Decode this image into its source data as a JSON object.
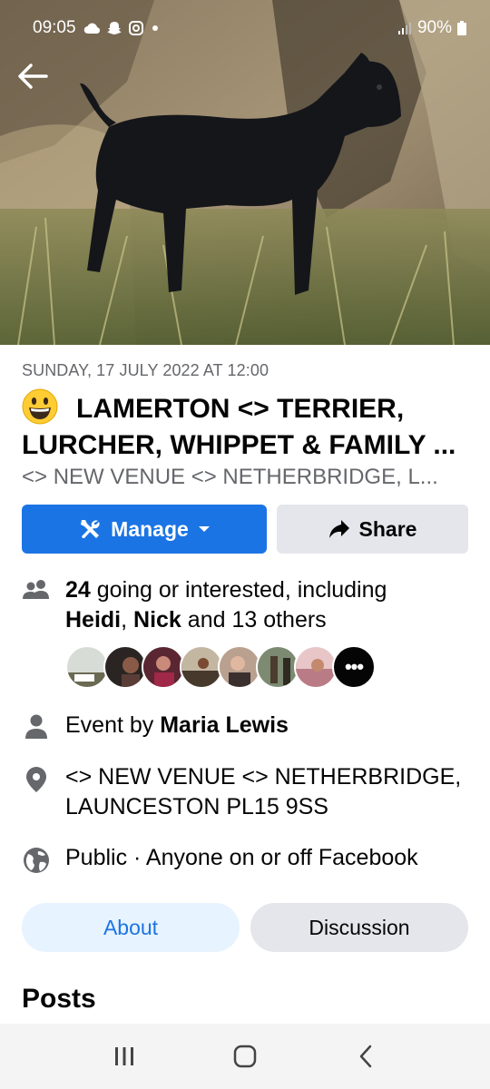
{
  "status_bar": {
    "time": "09:05",
    "battery": "90%",
    "icons": [
      "cloud-icon",
      "snapchat-icon",
      "instagram-icon",
      "dot-icon",
      "signal-icon",
      "battery-icon"
    ]
  },
  "cover": {
    "description_icon": "dog-photo"
  },
  "event": {
    "date": "SUNDAY, 17 JULY 2022 AT 12:00",
    "emoji": "grinning-face",
    "title_line1": "LAMERTON <> TERRIER,",
    "title_line2": "LURCHER, WHIPPET & FAMILY ...",
    "subtitle": "<> NEW VENUE <> NETHERBRIDGE, L..."
  },
  "actions": {
    "manage_label": "Manage",
    "share_label": "Share"
  },
  "attendance": {
    "count": "24",
    "text_after_count": " going or interested, including",
    "name1": "Heidi",
    "separator": ", ",
    "name2": "Nick",
    "text_end": " and 13 others",
    "more": "•••"
  },
  "host": {
    "prefix": "Event by ",
    "name": "Maria Lewis"
  },
  "location": {
    "line1": "<> NEW VENUE <> NETHERBRIDGE,",
    "line2": "LAUNCESTON PL15 9SS"
  },
  "privacy": {
    "text": "Public · Anyone on or off Facebook"
  },
  "tabs": {
    "about": "About",
    "discussion": "Discussion"
  },
  "posts_heading": "Posts",
  "colors": {
    "primary": "#1b74e4",
    "secondary_bg": "#e4e6eb",
    "secondary_text": "#65676b",
    "tab_active_bg": "#e7f3ff"
  }
}
